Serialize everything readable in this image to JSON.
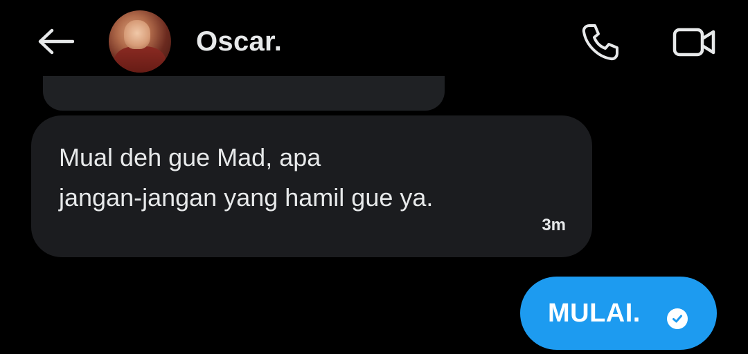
{
  "header": {
    "contact_name": "Oscar.",
    "back_icon": "arrow-left-icon",
    "call_icon": "phone-icon",
    "video_icon": "video-camera-icon"
  },
  "messages": [
    {
      "direction": "received",
      "line1": "Mual deh gue Mad, apa",
      "line2": "jangan-jangan yang hamil gue ya.",
      "time": "3m"
    },
    {
      "direction": "sent",
      "text": "MULAI.",
      "status_icon": "check-circle-icon"
    }
  ],
  "colors": {
    "background": "#000000",
    "received_bubble": "#1b1c1f",
    "sent_bubble": "#1d9bf0",
    "text": "#e7e9ea"
  }
}
